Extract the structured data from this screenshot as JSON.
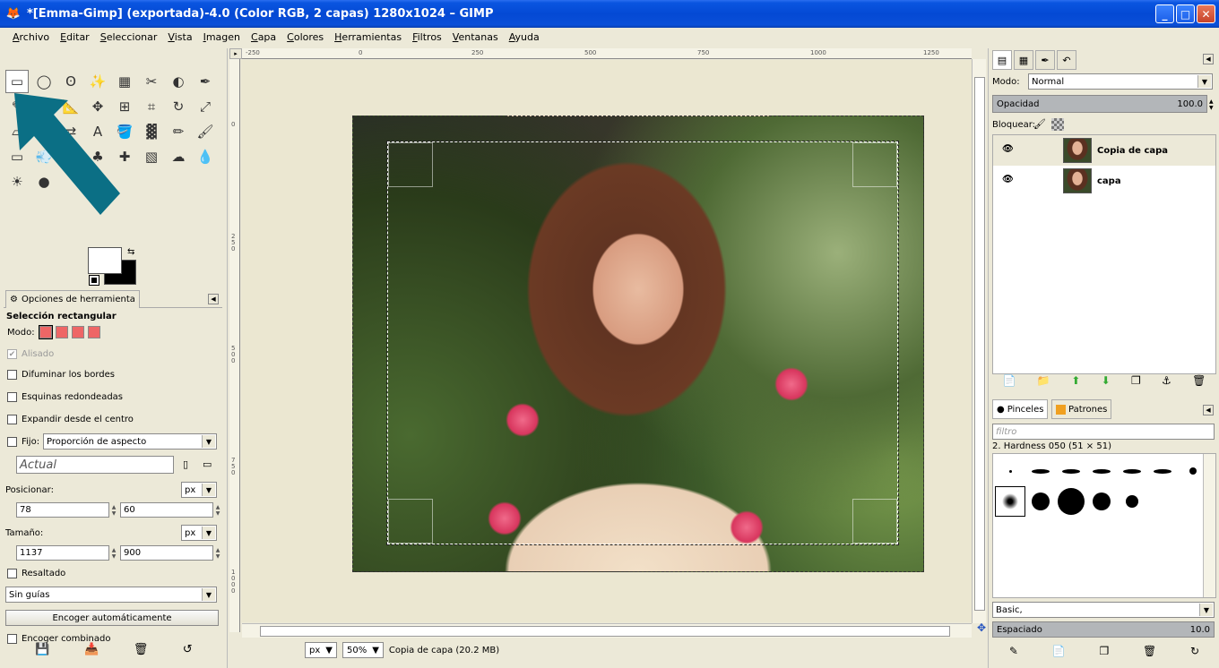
{
  "window": {
    "title": "*[Emma-Gimp] (exportada)-4.0 (Color RGB, 2 capas) 1280x1024 – GIMP",
    "app_icon": "gimp-wilber-icon",
    "btn_min": "_",
    "btn_max": "□",
    "btn_close": "✕"
  },
  "menu": [
    "Archivo",
    "Editar",
    "Seleccionar",
    "Vista",
    "Imagen",
    "Capa",
    "Colores",
    "Herramientas",
    "Filtros",
    "Ventanas",
    "Ayuda"
  ],
  "toolbox": {
    "tools": [
      "rect-select-icon",
      "ellipse-select-icon",
      "lasso-icon",
      "magic-wand-icon",
      "select-by-color-icon",
      "scissors-icon",
      "foreground-select-icon",
      "paths-icon",
      "color-picker-icon",
      "zoom-icon",
      "measure-icon",
      "move-icon",
      "align-icon",
      "crop-icon",
      "rotate-icon",
      "scale-icon",
      "shear-icon",
      "perspective-icon",
      "flip-icon",
      "text-icon",
      "bucket-fill-icon",
      "blend-icon",
      "pencil-icon",
      "paintbrush-icon",
      "eraser-icon",
      "airbrush-icon",
      "ink-icon",
      "clone-icon",
      "heal-icon",
      "perspective-clone-icon",
      "smudge-icon",
      "blur-icon",
      "dodge-burn-icon",
      "dodge-icon"
    ],
    "tool_glyphs": [
      "▭",
      "◯",
      "ʘ",
      "✨",
      "▦",
      "✂",
      "◐",
      "✒",
      "✎",
      "⌕",
      "📐",
      "✥",
      "⊞",
      "⌗",
      "↻",
      "⤢",
      "▱",
      "⬚",
      "⇄",
      "A",
      "🪣",
      "▓",
      "✏",
      "🖌",
      "▭",
      "💨",
      "✒",
      "♣",
      "✚",
      "▧",
      "☁",
      "💧",
      "☀",
      "●"
    ],
    "swap_glyph": "⇆",
    "options_tab": "Opciones de herramienta",
    "options_title": "Selección rectangular",
    "mode_label": "Modo:",
    "antialias": "Alisado",
    "feather": "Difuminar los bordes",
    "rounded": "Esquinas redondeadas",
    "expand": "Expandir desde el centro",
    "fixed": "Fijo:",
    "fixed_value": "Proporción de aspecto",
    "current": "Actual",
    "position_label": "Posicionar:",
    "position_unit": "px",
    "pos_x": "78",
    "pos_y": "60",
    "size_label": "Tamaño:",
    "size_unit": "px",
    "size_w": "1137",
    "size_h": "900",
    "highlight": "Resaltado",
    "guides": "Sin guías",
    "autoshrink": "Encoger automáticamente",
    "shrink_merged": "Encoger combinado",
    "check_mark": "✔",
    "dropdown_glyph": "▼",
    "collapse_glyph": "◀"
  },
  "canvas": {
    "ruler_h": [
      "-250",
      "0",
      "250",
      "500",
      "750",
      "1000",
      "1250"
    ],
    "ruler_v": [
      "0",
      "2 5 0",
      "5 0 0",
      "7 5 0",
      "1 0 0 0"
    ],
    "unit": "px",
    "zoom": "50%",
    "status": "Copia de capa (20.2 MB)"
  },
  "layers": {
    "mode_label": "Modo:",
    "mode_value": "Normal",
    "opacity_label": "Opacidad",
    "opacity_value": "100.0",
    "lock_label": "Bloquear:",
    "items": [
      {
        "name": "Copia de capa",
        "visible": true,
        "selected": true
      },
      {
        "name": "capa",
        "visible": true,
        "selected": false
      }
    ],
    "eye_glyph": "👁"
  },
  "brushes": {
    "tab_brushes": "Pinceles",
    "tab_patterns": "Patrones",
    "filter_placeholder": "filtro",
    "selected": "2. Hardness 050 (51 × 51)",
    "preset": "Basic,",
    "spacing_label": "Espaciado",
    "spacing_value": "10.0"
  },
  "colors": {
    "foreground": "#ffffff",
    "background": "#000000",
    "accent_arrow": "#0b6f85",
    "titlebar": "#0449d4"
  }
}
